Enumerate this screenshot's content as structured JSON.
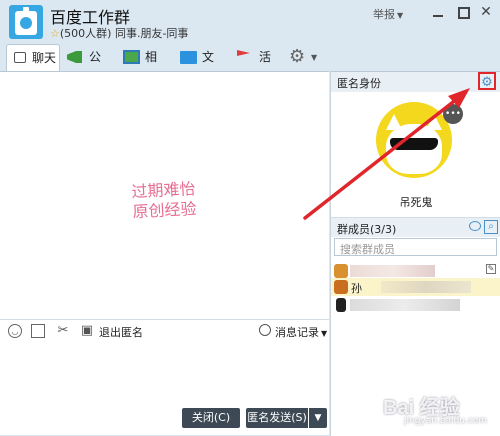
{
  "window": {
    "group_name": "百度工作群",
    "group_meta": "(500人群) 同事.朋友-同事",
    "report_label": "举报",
    "controls": {
      "minimize": "",
      "maximize": "",
      "close": "✕"
    }
  },
  "tabs": [
    {
      "label": "聊天",
      "icon": "chat-bubble-icon",
      "active": true
    },
    {
      "label": "公告",
      "icon": "megaphone-icon"
    },
    {
      "label": "相册",
      "icon": "photo-album-icon"
    },
    {
      "label": "文件",
      "icon": "folder-icon"
    },
    {
      "label": "活动",
      "icon": "flag-icon"
    }
  ],
  "chat": {
    "watermark_line1": "过期难怡",
    "watermark_line2": "原创经验"
  },
  "input_toolbar": {
    "exit_anonymous_label": "退出匿名",
    "history_label": "消息记录"
  },
  "buttons": {
    "close_label": "关闭(C)",
    "send_label": "匿名发送(S)"
  },
  "right_panel": {
    "anonymous_title": "匿名身份",
    "anonymous_name": "吊死鬼",
    "avatar_badge": "•••",
    "members_title": "群成员(3/3)",
    "members_search_placeholder": "搜索群成员",
    "members": [
      {
        "name": ""
      },
      {
        "name": "孙"
      },
      {
        "name": ""
      }
    ]
  },
  "footer_watermark": {
    "brand": "Bai 经验",
    "url": "jingyan.baidu.com"
  },
  "colors": {
    "accent": "#37a7e4",
    "highlight_border": "#e0262a",
    "button_dark": "#3d4a55",
    "panel_header": "#e8eff5"
  }
}
